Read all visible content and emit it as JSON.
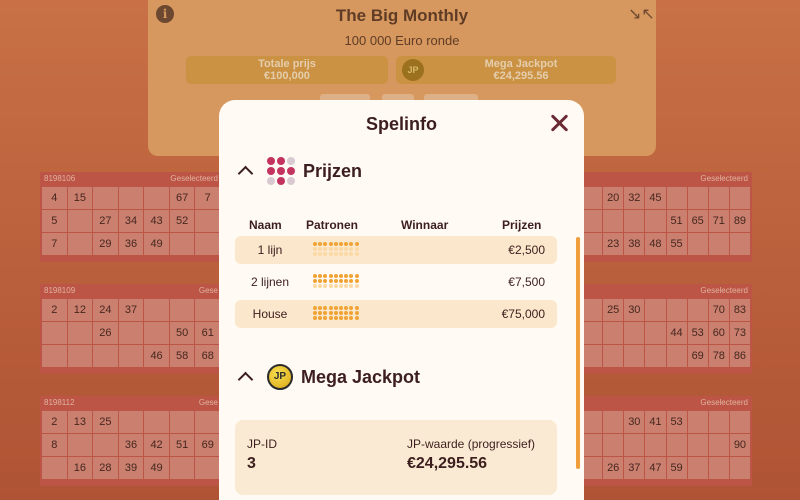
{
  "background": {
    "header": {
      "title": "The Big Monthly",
      "subtitle": "100 000 Euro ronde",
      "total_prize_label": "Totale prijs",
      "total_prize_value": "€100,000",
      "jackpot_label": "Mega Jackpot",
      "jackpot_value": "€24,295.56",
      "jp_badge": "JP"
    },
    "tickets_left": [
      {
        "id": "8198106",
        "rows": [
          [
            "4",
            "15",
            "",
            "",
            "",
            "67",
            "7"
          ],
          [
            "5",
            "",
            "27",
            "34",
            "43",
            "52",
            ""
          ],
          [
            "7",
            "",
            "29",
            "36",
            "49",
            "",
            ""
          ]
        ]
      },
      {
        "id": "8198109",
        "label": "Gese",
        "rows": [
          [
            "2",
            "12",
            "24",
            "37",
            "",
            "",
            ""
          ],
          [
            "",
            "",
            "26",
            "",
            "",
            "50",
            "61",
            "7"
          ],
          [
            "",
            "",
            "",
            "",
            "46",
            "58",
            "68",
            "7"
          ]
        ]
      },
      {
        "id": "8198112",
        "label": "Gese",
        "rows": [
          [
            "2",
            "13",
            "25",
            "",
            "",
            "",
            ""
          ],
          [
            "8",
            "",
            "",
            "36",
            "42",
            "51",
            "69"
          ],
          [
            "",
            "16",
            "28",
            "39",
            "49",
            "",
            ""
          ]
        ]
      }
    ],
    "tickets_right": [
      {
        "label": "Geselecteerd",
        "rows": [
          [
            "",
            "20",
            "32",
            "45",
            "",
            "",
            "",
            ""
          ],
          [
            "",
            "",
            "",
            "",
            "51",
            "65",
            "71",
            "89"
          ],
          [
            "",
            "23",
            "38",
            "48",
            "55",
            "",
            "",
            ""
          ]
        ]
      },
      {
        "label": "Geselecteerd",
        "rows": [
          [
            "",
            "25",
            "30",
            "",
            "",
            "",
            "70",
            "83"
          ],
          [
            "",
            "",
            "",
            "",
            "44",
            "53",
            "60",
            "73"
          ],
          [
            "",
            "",
            "",
            "",
            "",
            "69",
            "78",
            "86"
          ]
        ]
      },
      {
        "label": "Geselecteerd",
        "rows": [
          [
            "",
            "",
            "30",
            "41",
            "53",
            "",
            "",
            ""
          ],
          [
            "",
            "",
            "",
            "",
            "",
            "",
            "",
            "90"
          ],
          [
            "",
            "26",
            "37",
            "47",
            "59",
            "",
            "",
            ""
          ]
        ]
      }
    ],
    "selected_label": "Geselecteerd"
  },
  "modal": {
    "title": "Spelinfo",
    "sections": {
      "prizes": {
        "label": "Prijzen",
        "columns": [
          "Naam",
          "Patronen",
          "Winnaar",
          "Prijzen"
        ],
        "rows": [
          {
            "name": "1 lijn",
            "amount": "€2,500",
            "pattern_rows": 1
          },
          {
            "name": "2 lijnen",
            "amount": "€7,500",
            "pattern_rows": 2
          },
          {
            "name": "House",
            "amount": "€75,000",
            "pattern_rows": 3
          }
        ]
      },
      "jackpot": {
        "label": "Mega Jackpot",
        "icon_text": "JP",
        "id_label": "JP-ID",
        "id_value": "3",
        "value_label": "JP-waarde (progressief)",
        "value": "€24,295.56"
      }
    }
  },
  "colors": {
    "accent_orange": "#f29e3b",
    "modal_bg": "#fffaf3",
    "row_shade": "#fbe7cc",
    "dark_text": "#3d1e1e",
    "close_icon": "#6a2b35",
    "dots_highlight": "#c3335f",
    "jp_gold": "#f8df52"
  }
}
